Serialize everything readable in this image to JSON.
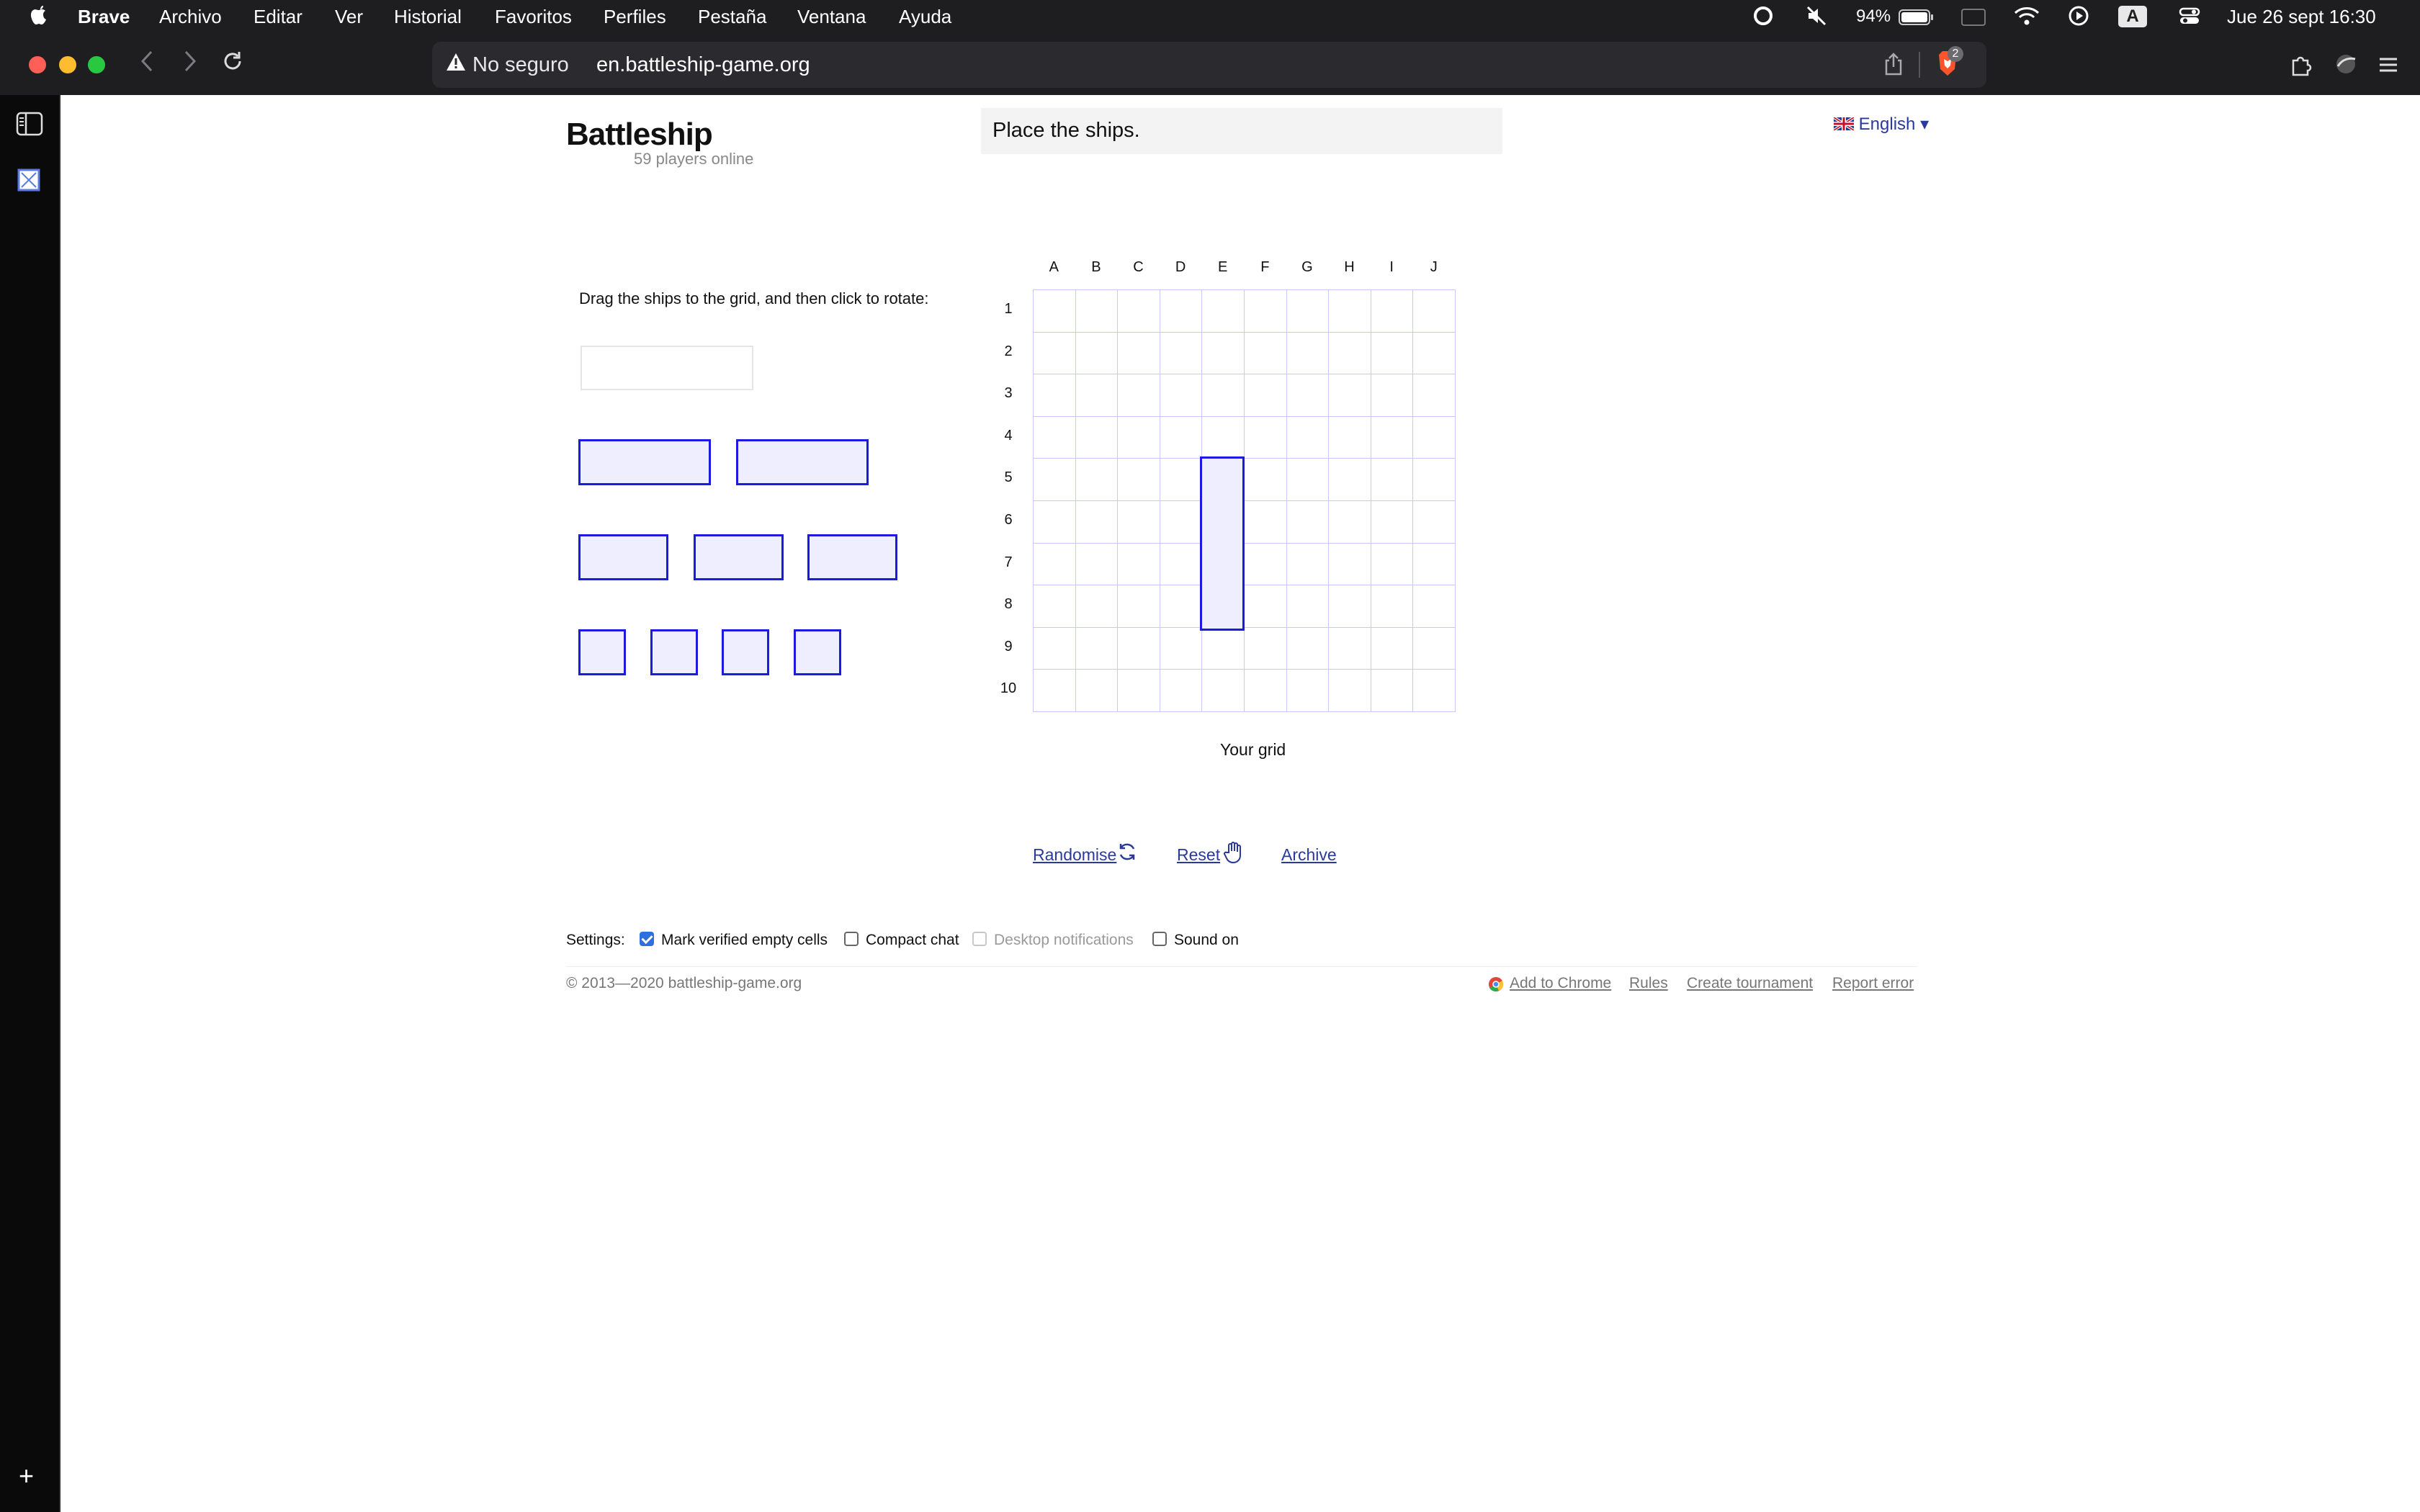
{
  "menubar": {
    "apple_icon": "apple-icon",
    "app_name": "Brave",
    "items": [
      "Archivo",
      "Editar",
      "Ver",
      "Historial",
      "Favoritos",
      "Perfiles",
      "Pestaña",
      "Ventana",
      "Ayuda"
    ],
    "battery": "94%",
    "keyboard": "A",
    "datetime": "Jue 26 sept  16:30"
  },
  "browser": {
    "security_label": "No seguro",
    "url": "en.battleship-game.org",
    "shield_badge": "2"
  },
  "page": {
    "logo": "Battleship",
    "players_online": "59 players online",
    "status": "Place the ships.",
    "language": "English",
    "instructions": "Drag the ships to the grid, and then click to rotate:",
    "grid": {
      "columns": [
        "A",
        "B",
        "C",
        "D",
        "E",
        "F",
        "G",
        "H",
        "I",
        "J"
      ],
      "rows": [
        "1",
        "2",
        "3",
        "4",
        "5",
        "6",
        "7",
        "8",
        "9",
        "10"
      ],
      "caption": "Your grid",
      "placed_ship": {
        "column": "E",
        "from_row": 5,
        "to_row": 8,
        "orientation": "vertical"
      }
    },
    "ships_palette": {
      "placed_slot": "4-deck (on grid)",
      "three_deck": 2,
      "two_deck": 3,
      "one_deck": 4
    },
    "actions": {
      "randomise": "Randomise",
      "reset": "Reset",
      "archive": "Archive"
    },
    "settings": {
      "label": "Settings:",
      "options": [
        {
          "label": "Mark verified empty cells",
          "checked": true,
          "disabled": false
        },
        {
          "label": "Compact chat",
          "checked": false,
          "disabled": false
        },
        {
          "label": "Desktop notifications",
          "checked": false,
          "disabled": true
        },
        {
          "label": "Sound on",
          "checked": false,
          "disabled": false
        }
      ]
    },
    "footer": {
      "copyright": "© 2013—2020 battleship-game.org",
      "links": [
        "Add to Chrome",
        "Rules",
        "Create tournament",
        "Report error"
      ]
    }
  },
  "colors": {
    "ship_border": "#1a1ae0",
    "ship_fill": "#eeeefe",
    "grid_line": "#c9c9f2",
    "link": "#2a3a9c"
  }
}
